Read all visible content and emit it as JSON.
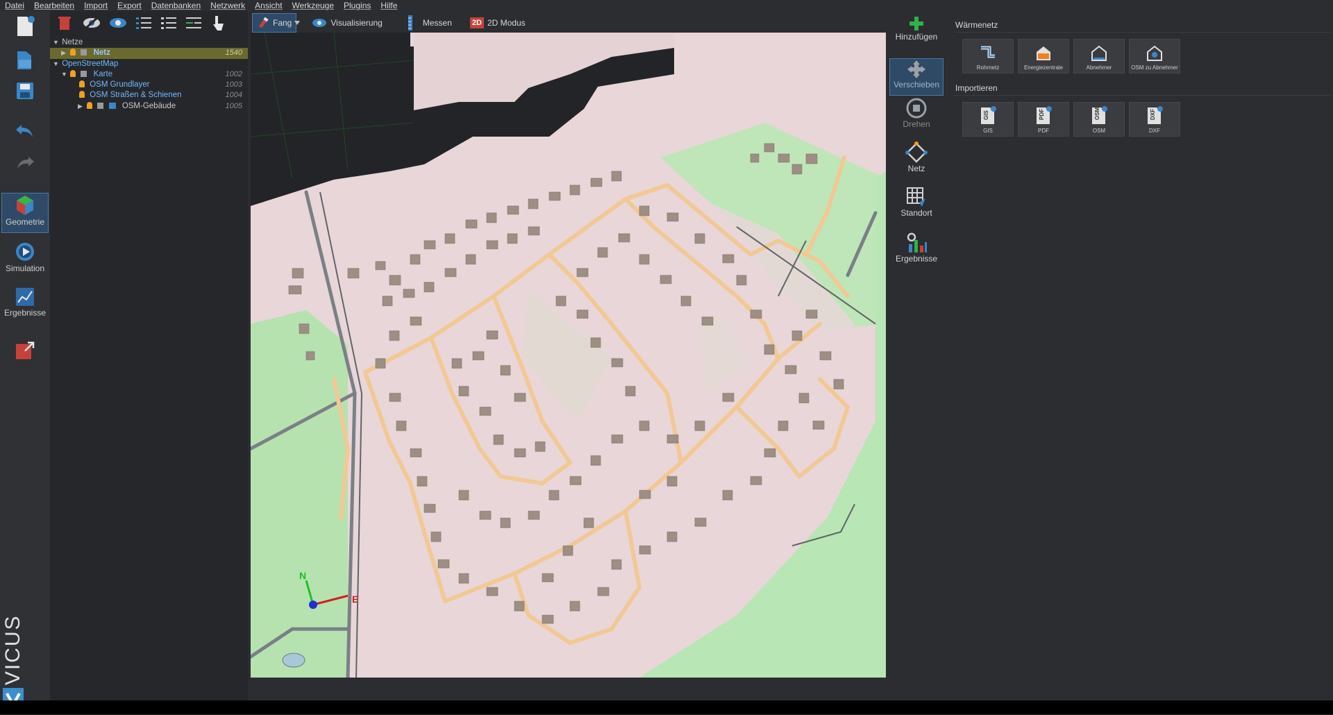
{
  "menu": [
    "Datei",
    "Bearbeiten",
    "Import",
    "Export",
    "Datenbanken",
    "Netzwerk",
    "Ansicht",
    "Werkzeuge",
    "Plugins",
    "Hilfe"
  ],
  "left_rail": {
    "geometrie": "Geometrie",
    "simulation": "Simulation",
    "ergebnisse": "Ergebnisse",
    "brand": "VICUS"
  },
  "tree": {
    "netze": "Netze",
    "netz": {
      "label": "Netz",
      "id": "1540"
    },
    "osm": "OpenStreetMap",
    "karte": {
      "label": "Karte",
      "id": "1002"
    },
    "grundlayer": {
      "label": "OSM Grundlayer",
      "id": "1003"
    },
    "strassen": {
      "label": "OSM Straßen & Schienen",
      "id": "1004"
    },
    "gebaeude": {
      "label": "OSM-Gebäude",
      "id": "1005"
    }
  },
  "viewbar": {
    "fang": "Fang",
    "visualisierung": "Visualisierung",
    "messen": "Messen",
    "modus_badge": "2D",
    "modus": "2D Modus"
  },
  "tools": {
    "hinzufuegen": "Hinzufügen",
    "verschieben": "Verschieben",
    "drehen": "Drehen",
    "netz": "Netz",
    "standort": "Standort",
    "ergebnisse": "Ergebnisse"
  },
  "waermenetz": {
    "title": "Wärmenetz",
    "items": [
      "Rohrnetz",
      "Energiezentrale",
      "Abnehmer",
      "OSM zu Abnehmer"
    ]
  },
  "importieren": {
    "title": "Importieren",
    "items": [
      "GIS",
      "PDF",
      "OSM",
      "DXF"
    ],
    "badges": [
      "GIS",
      "PDF",
      "OSM",
      "DXF"
    ]
  },
  "axes": {
    "north": "N",
    "east": "E"
  },
  "colors": {
    "accent": "#4a7aa8",
    "selected_row": "#6b6a2e",
    "map_residential": "#e9d6d8",
    "map_green": "#b8e6b4",
    "road": "#f2c894",
    "building": "#9d8f84"
  }
}
